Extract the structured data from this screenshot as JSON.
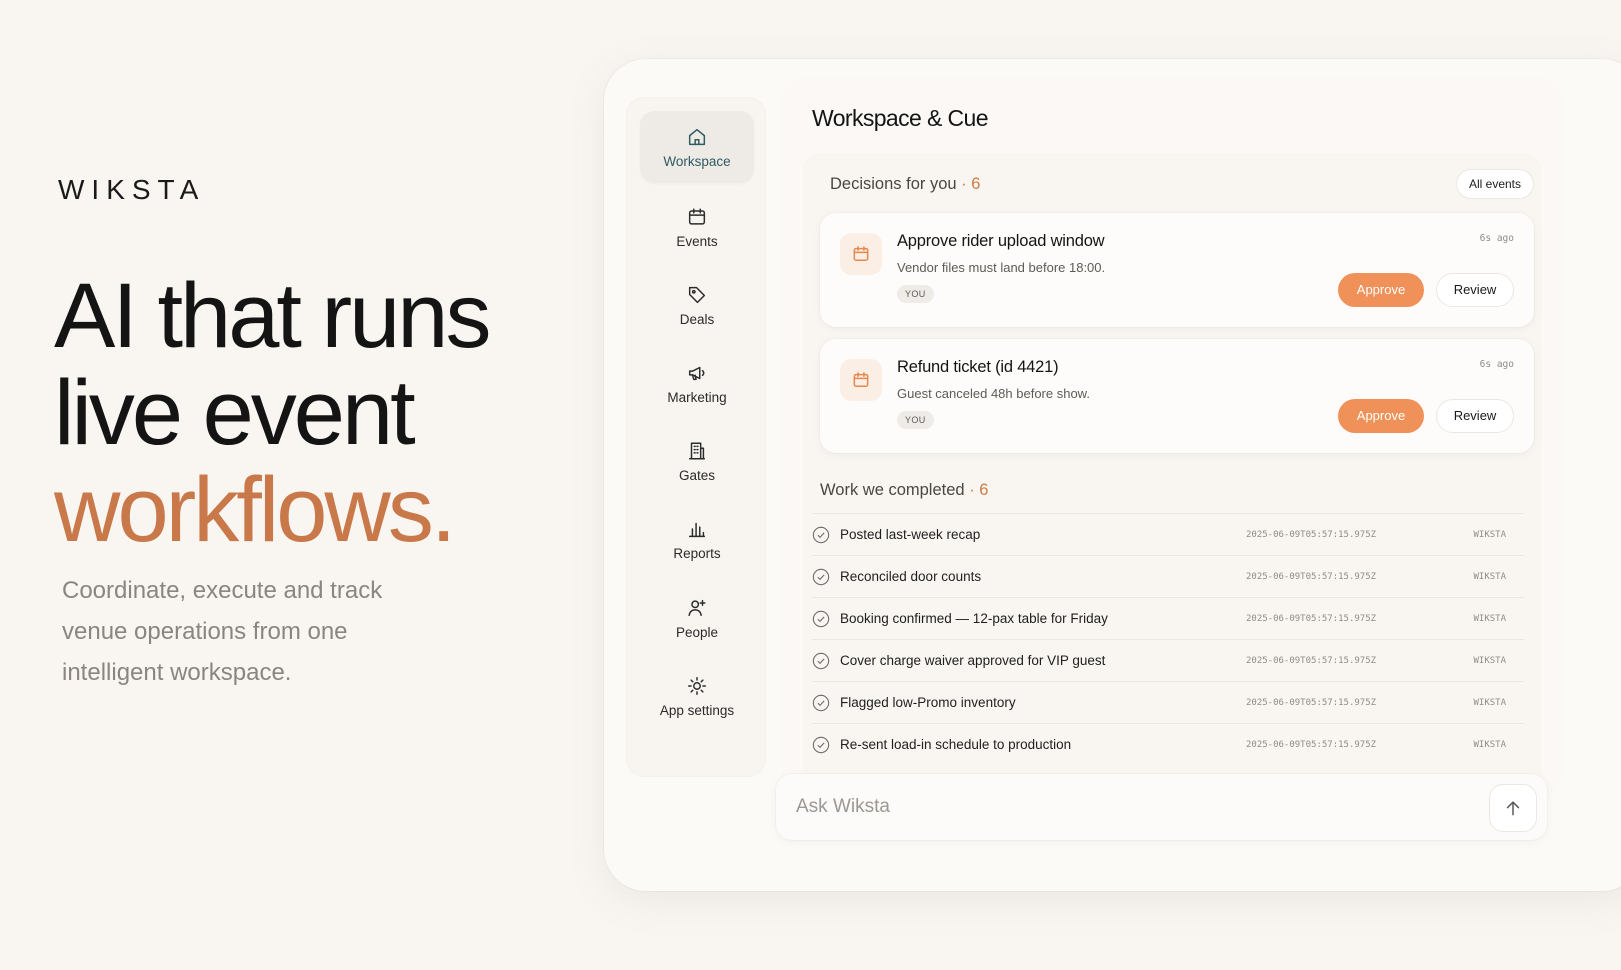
{
  "brand": "WIKSTA",
  "hero": {
    "line1": "AI that runs",
    "line2": "live event",
    "line3": "workflows.",
    "subtitle": "Coordinate, execute and track venue operations from one intelligent workspace."
  },
  "colors": {
    "accent": "#c9784a",
    "approve": "#ef9158",
    "active_nav": "#2e5b60"
  },
  "sidebar": {
    "items": [
      {
        "label": "Workspace",
        "icon": "home-icon",
        "active": true
      },
      {
        "label": "Events",
        "icon": "calendar-icon",
        "active": false
      },
      {
        "label": "Deals",
        "icon": "tag-icon",
        "active": false
      },
      {
        "label": "Marketing",
        "icon": "megaphone-icon",
        "active": false
      },
      {
        "label": "Gates",
        "icon": "building-icon",
        "active": false
      },
      {
        "label": "Reports",
        "icon": "bar-chart-icon",
        "active": false
      },
      {
        "label": "People",
        "icon": "user-plus-icon",
        "active": false
      },
      {
        "label": "App settings",
        "icon": "sun-gear-icon",
        "active": false
      }
    ]
  },
  "main": {
    "title": "Workspace & Cue",
    "decisions": {
      "label": "Decisions for you",
      "separator": "·",
      "count": "6",
      "all_events_label": "All events",
      "cards": [
        {
          "title": "Approve rider upload window",
          "description": "Vendor files must land before 18:00.",
          "tag": "YOU",
          "time": "6s ago",
          "approve_label": "Approve",
          "review_label": "Review"
        },
        {
          "title": "Refund ticket (id 4421)",
          "description": "Guest canceled 48h before show.",
          "tag": "YOU",
          "time": "6s ago",
          "approve_label": "Approve",
          "review_label": "Review"
        }
      ]
    },
    "completed": {
      "label": "Work we completed",
      "separator": "·",
      "count": "6",
      "rows": [
        {
          "text": "Posted last-week recap",
          "timestamp": "2025-06-09T05:57:15.975Z",
          "source": "WIKSTA"
        },
        {
          "text": "Reconciled door counts",
          "timestamp": "2025-06-09T05:57:15.975Z",
          "source": "WIKSTA"
        },
        {
          "text": "Booking confirmed — 12-pax table for Friday",
          "timestamp": "2025-06-09T05:57:15.975Z",
          "source": "WIKSTA"
        },
        {
          "text": "Cover charge waiver approved for VIP guest",
          "timestamp": "2025-06-09T05:57:15.975Z",
          "source": "WIKSTA"
        },
        {
          "text": "Flagged low-Promo inventory",
          "timestamp": "2025-06-09T05:57:15.975Z",
          "source": "WIKSTA"
        },
        {
          "text": "Re-sent load-in schedule to production",
          "timestamp": "2025-06-09T05:57:15.975Z",
          "source": "WIKSTA"
        }
      ]
    }
  },
  "ask": {
    "placeholder": "Ask Wiksta",
    "value": "",
    "send_icon": "arrow-up-icon"
  }
}
